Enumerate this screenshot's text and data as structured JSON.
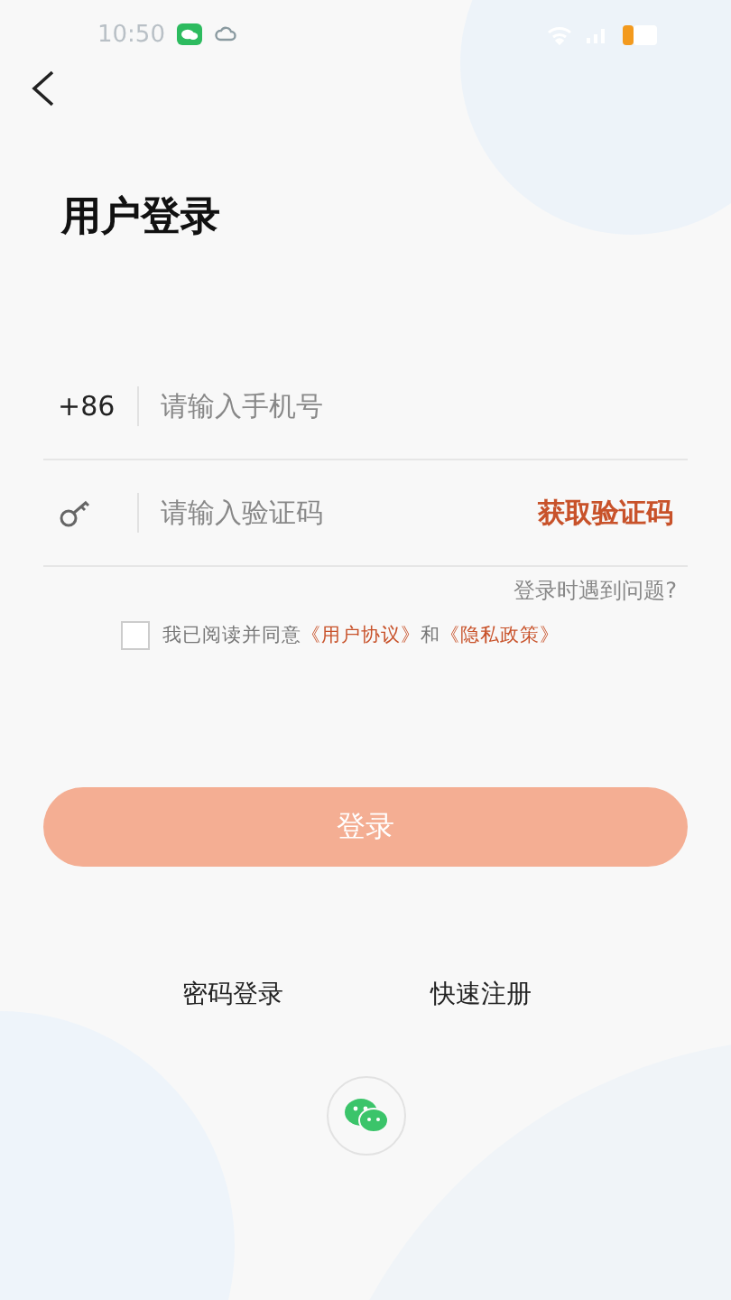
{
  "status_bar": {
    "time": "10:50"
  },
  "title": "用户登录",
  "phone_field": {
    "prefix": "+86",
    "placeholder": "请输入手机号"
  },
  "code_field": {
    "placeholder": "请输入验证码",
    "action": "获取验证码"
  },
  "help_link": "登录时遇到问题?",
  "agreement": {
    "checked": false,
    "text": "我已阅读并同意",
    "links": [
      "《用户协议》",
      "《隐私政策》"
    ],
    "joiner": "和"
  },
  "login_button": {
    "label": "登录",
    "disabled": true
  },
  "alt_links": [
    "密码登录",
    "快速注册"
  ]
}
